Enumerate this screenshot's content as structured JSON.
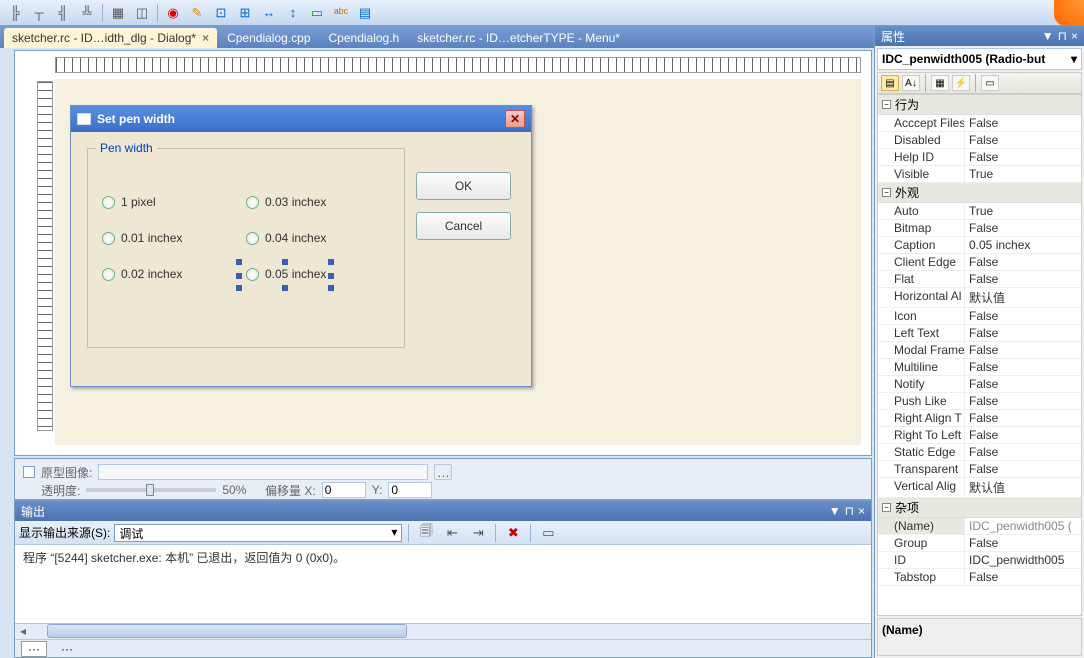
{
  "toolbar_icons": [
    "align-left",
    "align-top",
    "align-right",
    "align-bottom",
    "grid",
    "crop",
    "",
    "color-wheel",
    "balloon",
    "zoom-fit",
    "zoom",
    "arrow-left",
    "arrow-up",
    "ruler",
    "text",
    "doc"
  ],
  "tabs": [
    {
      "label": "sketcher.rc - ID…idth_dlg - Dialog*",
      "active": true,
      "closable": true
    },
    {
      "label": "Cpendialog.cpp",
      "active": false
    },
    {
      "label": "Cpendialog.h",
      "active": false
    },
    {
      "label": "sketcher.rc - ID…etcherTYPE - Menu*",
      "active": false
    }
  ],
  "dialog": {
    "title": "Set pen width",
    "group_title": "Pen width",
    "radios": [
      "1 pixel",
      "0.03 inchex",
      "0.01 inchex",
      "0.04 inchex",
      "0.02 inchex",
      "0.05 inchex"
    ],
    "ok": "OK",
    "cancel": "Cancel"
  },
  "img_bar": {
    "checkbox_label": "原型图像:",
    "opacity_label": "透明度:",
    "opacity_value": "50%",
    "offset_label": "偏移量 X:",
    "x": "0",
    "y_label": "Y:",
    "y": "0"
  },
  "output": {
    "title": "输出",
    "source_label": "显示输出来源(S):",
    "source_value": "调试",
    "line": "程序 “[5244] sketcher.exe: 本机” 已退出，返回值为 0 (0x0)。"
  },
  "props": {
    "title": "属性",
    "object": "IDC_penwidth005 (Radio-but",
    "categories": [
      {
        "name": "行为",
        "rows": [
          {
            "n": "Acccept Files",
            "v": "False"
          },
          {
            "n": "Disabled",
            "v": "False"
          },
          {
            "n": "Help ID",
            "v": "False"
          },
          {
            "n": "Visible",
            "v": "True"
          }
        ]
      },
      {
        "name": "外观",
        "rows": [
          {
            "n": "Auto",
            "v": "True"
          },
          {
            "n": "Bitmap",
            "v": "False"
          },
          {
            "n": "Caption",
            "v": "0.05 inchex"
          },
          {
            "n": "Client Edge",
            "v": "False"
          },
          {
            "n": "Flat",
            "v": "False"
          },
          {
            "n": "Horizontal Al",
            "v": "默认值"
          },
          {
            "n": "Icon",
            "v": "False"
          },
          {
            "n": "Left Text",
            "v": "False"
          },
          {
            "n": "Modal Frame",
            "v": "False"
          },
          {
            "n": "Multiline",
            "v": "False"
          },
          {
            "n": "Notify",
            "v": "False"
          },
          {
            "n": "Push Like",
            "v": "False"
          },
          {
            "n": "Right Align T",
            "v": "False"
          },
          {
            "n": "Right To Left",
            "v": "False"
          },
          {
            "n": "Static Edge",
            "v": "False"
          },
          {
            "n": "Transparent",
            "v": "False"
          },
          {
            "n": "Vertical Alig",
            "v": "默认值"
          }
        ]
      },
      {
        "name": "杂项",
        "rows": [
          {
            "n": "(Name)",
            "v": "IDC_penwidth005 (",
            "sel": true
          },
          {
            "n": "Group",
            "v": "False"
          },
          {
            "n": "ID",
            "v": "IDC_penwidth005"
          },
          {
            "n": "Tabstop",
            "v": "False"
          }
        ]
      }
    ],
    "desc": "(Name)"
  }
}
